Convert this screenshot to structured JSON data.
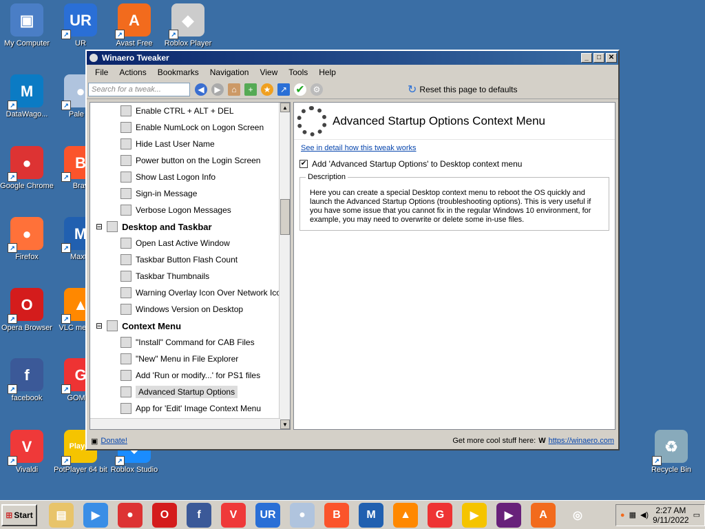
{
  "desktop": {
    "icons": [
      {
        "label": "My Computer",
        "color": "#4a7ec6",
        "glyph": "▣"
      },
      {
        "label": "UR",
        "color": "#2a6fd6",
        "glyph": "UR"
      },
      {
        "label": "Avast Free",
        "color": "#f26b1d",
        "glyph": "A"
      },
      {
        "label": "Roblox Player",
        "color": "#ccc",
        "glyph": "◆"
      },
      {
        "label": "DataWago...",
        "color": "#0b7bc4",
        "glyph": "M"
      },
      {
        "label": "Pale M",
        "color": "#b0c4de",
        "glyph": "●"
      },
      {
        "label": "Google Chrome",
        "color": "#d33",
        "glyph": "●"
      },
      {
        "label": "Brav",
        "color": "#fb542b",
        "glyph": "B"
      },
      {
        "label": "Firefox",
        "color": "#ff7139",
        "glyph": "●"
      },
      {
        "label": "Maxth",
        "color": "#2160b0",
        "glyph": "M"
      },
      {
        "label": "Opera Browser",
        "color": "#d41c1c",
        "glyph": "O"
      },
      {
        "label": "VLC me play",
        "color": "#f80",
        "glyph": "▲"
      },
      {
        "label": "facebook",
        "color": "#3b5998",
        "glyph": "f"
      },
      {
        "label": "GOM Pl",
        "color": "#e33",
        "glyph": "G"
      },
      {
        "label": "Vivaldi",
        "color": "#ef3939",
        "glyph": "V"
      },
      {
        "label": "PotPlayer 64 bit",
        "color": "#f5c400",
        "glyph": "Player"
      },
      {
        "label": "Roblox Studio",
        "color": "#1a8cff",
        "glyph": "◆"
      },
      {
        "label": "Recycle Bin",
        "color": "#8ab",
        "glyph": "♻"
      }
    ]
  },
  "window": {
    "title": "Winaero Tweaker"
  },
  "menu": [
    "File",
    "Actions",
    "Bookmarks",
    "Navigation",
    "View",
    "Tools",
    "Help"
  ],
  "toolbar": {
    "search_placeholder": "Search for a tweak...",
    "reset_label": "Reset this page to defaults"
  },
  "tree": {
    "items": [
      {
        "label": "Enable CTRL + ALT + DEL",
        "cat": false
      },
      {
        "label": "Enable NumLock on Logon Screen",
        "cat": false
      },
      {
        "label": "Hide Last User Name",
        "cat": false
      },
      {
        "label": "Power button on the Login Screen",
        "cat": false
      },
      {
        "label": "Show Last Logon Info",
        "cat": false
      },
      {
        "label": "Sign-in Message",
        "cat": false
      },
      {
        "label": "Verbose Logon Messages",
        "cat": false
      },
      {
        "label": "Desktop and Taskbar",
        "cat": true
      },
      {
        "label": "Open Last Active Window",
        "cat": false
      },
      {
        "label": "Taskbar Button Flash Count",
        "cat": false
      },
      {
        "label": "Taskbar Thumbnails",
        "cat": false
      },
      {
        "label": "Warning Overlay Icon Over Network Icon in",
        "cat": false
      },
      {
        "label": "Windows Version on Desktop",
        "cat": false
      },
      {
        "label": "Context Menu",
        "cat": true
      },
      {
        "label": "\"Install\" Command for CAB Files",
        "cat": false
      },
      {
        "label": "\"New\" Menu in File Explorer",
        "cat": false
      },
      {
        "label": "Add 'Run or modify...' for PS1 files",
        "cat": false
      },
      {
        "label": "Advanced Startup Options",
        "cat": false,
        "selected": true
      },
      {
        "label": "App for 'Edit' Image Context Menu",
        "cat": false
      }
    ]
  },
  "panel": {
    "title": "Advanced Startup Options Context Menu",
    "link": "See in detail how this tweak works",
    "checkbox_label": "Add 'Advanced Startup Options' to Desktop context menu",
    "checked": true,
    "desc_legend": "Description",
    "desc_text": "Here you can create a special Desktop context menu to reboot the OS quickly and launch the Advanced Startup Options (troubleshooting options). This is very useful if you have some issue that you cannot fix in the regular Windows 10 environment, for example, you may need to overwrite or delete some in-use files."
  },
  "status": {
    "donate": "Donate!",
    "more": "Get more cool stuff here:",
    "url": "https://winaero.com"
  },
  "taskbar": {
    "start": "Start",
    "apps": [
      {
        "name": "explorer",
        "color": "#e8c46a",
        "glyph": "▤"
      },
      {
        "name": "media",
        "color": "#3a8ee6",
        "glyph": "▶"
      },
      {
        "name": "chrome",
        "color": "#d33",
        "glyph": "●"
      },
      {
        "name": "opera",
        "color": "#d41c1c",
        "glyph": "O"
      },
      {
        "name": "facebook",
        "color": "#3b5998",
        "glyph": "f"
      },
      {
        "name": "vivaldi",
        "color": "#ef3939",
        "glyph": "V"
      },
      {
        "name": "ur",
        "color": "#2a6fd6",
        "glyph": "UR"
      },
      {
        "name": "palemoon",
        "color": "#b0c4de",
        "glyph": "●"
      },
      {
        "name": "brave",
        "color": "#fb542b",
        "glyph": "B"
      },
      {
        "name": "maxthon",
        "color": "#2160b0",
        "glyph": "M"
      },
      {
        "name": "vlc",
        "color": "#f80",
        "glyph": "▲"
      },
      {
        "name": "gom",
        "color": "#e33",
        "glyph": "G"
      },
      {
        "name": "potplayer",
        "color": "#f5c400",
        "glyph": "▶"
      },
      {
        "name": "vstudio",
        "color": "#68217a",
        "glyph": "▶"
      },
      {
        "name": "avast",
        "color": "#f26b1d",
        "glyph": "A"
      },
      {
        "name": "winaero",
        "color": "#d4d0c8",
        "glyph": "◎"
      }
    ],
    "time": "2:27 AM",
    "date": "9/11/2022"
  }
}
